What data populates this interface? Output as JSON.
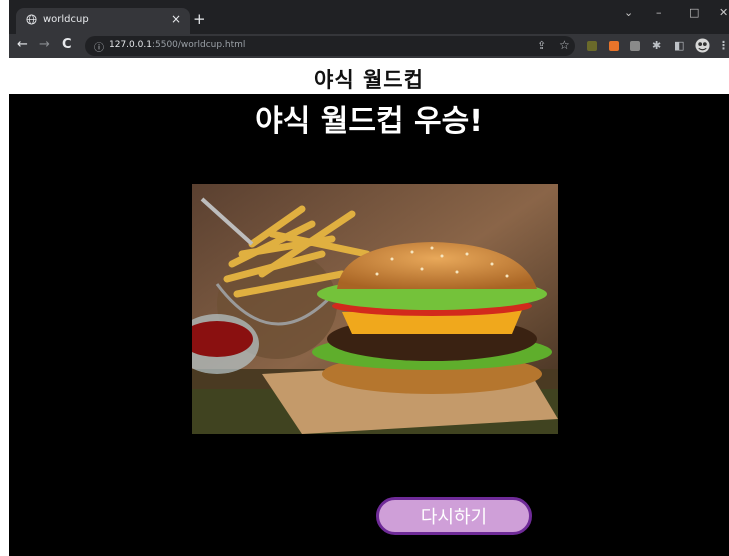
{
  "browser": {
    "tab_title": "worldcup",
    "tab_close": "×",
    "new_tab": "+",
    "window_controls": {
      "dropdown": "⌄",
      "minimize": "–",
      "maximize": "□",
      "close": "✕"
    },
    "nav": {
      "back": "←",
      "forward": "→",
      "reload": "C"
    },
    "url_info": "ⓘ",
    "url_host": "127.0.0.1",
    "url_path": ":5500/worldcup.html",
    "toolbar_icons": {
      "share": "⇪",
      "bookmark": "☆",
      "puzzle": "✱",
      "sidepanel": "◧",
      "menu": "⋮"
    },
    "extensions": [
      {
        "name": "ext-1",
        "color": "#6a6a2a"
      },
      {
        "name": "ext-2",
        "color": "#e8742a"
      },
      {
        "name": "ext-3",
        "color": "#8a8a8a"
      }
    ]
  },
  "page": {
    "site_title": "야식 월드컵",
    "winner_heading": "야식 월드컵 우승!",
    "retry_label": "다시하기"
  },
  "colors": {
    "page_bg": "#000000",
    "button_fill": "#cf9fd8",
    "button_border": "#6f2b98"
  },
  "icons": [
    "globe-icon",
    "back-icon",
    "forward-icon",
    "reload-icon",
    "info-icon",
    "share-icon",
    "bookmark-icon",
    "extensions-icon",
    "side-panel-icon",
    "profile-icon",
    "menu-icon"
  ]
}
